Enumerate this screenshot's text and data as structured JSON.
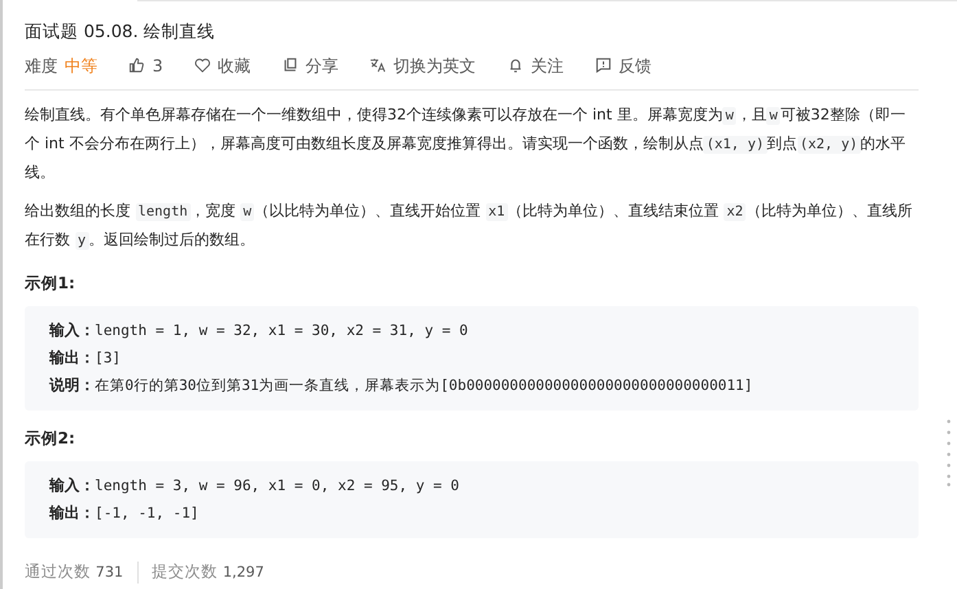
{
  "title": "面试题 05.08. 绘制直线",
  "meta": {
    "difficulty_label": "难度",
    "difficulty": "中等",
    "likes": "3",
    "actions": [
      {
        "kind": "star",
        "label": "收藏"
      },
      {
        "kind": "share",
        "label": "分享"
      },
      {
        "kind": "translate",
        "label": "切换为英文"
      },
      {
        "kind": "bell",
        "label": "关注"
      },
      {
        "kind": "feedback",
        "label": "反馈"
      }
    ]
  },
  "description": [
    [
      {
        "text": "绘制直线。有个单色屏幕存储在一个一维数组中，使得32个连续像素可以存放在一个 int 里。屏幕宽度为",
        "code": false
      },
      {
        "text": "w",
        "code": true
      },
      {
        "text": "，且",
        "code": false
      },
      {
        "text": "w",
        "code": true
      },
      {
        "text": "可被32整除（即一个 int 不会分布在两行上），屏幕高度可由数组长度及屏幕宽度推算得出。请实现一个函数，绘制从点",
        "code": false
      },
      {
        "text": "(x1, y)",
        "code": true
      },
      {
        "text": "到点",
        "code": false
      },
      {
        "text": "(x2, y)",
        "code": true
      },
      {
        "text": "的水平线。",
        "code": false
      }
    ],
    [
      {
        "text": "给出数组的长度 ",
        "code": false
      },
      {
        "text": "length",
        "code": true
      },
      {
        "text": "，宽度 ",
        "code": false
      },
      {
        "text": "w",
        "code": true
      },
      {
        "text": "（以比特为单位）、直线开始位置 ",
        "code": false
      },
      {
        "text": "x1",
        "code": true
      },
      {
        "text": "（比特为单位）、直线结束位置 ",
        "code": false
      },
      {
        "text": "x2",
        "code": true
      },
      {
        "text": "（比特为单位）、直线所在行数 ",
        "code": false
      },
      {
        "text": "y",
        "code": true
      },
      {
        "text": "。返回绘制过后的数组。",
        "code": false
      }
    ]
  ],
  "examples": [
    {
      "heading": "示例1:",
      "lines": [
        {
          "label": "输入：",
          "value": "length = 1, w = 32, x1 = 30, x2 = 31, y = 0"
        },
        {
          "label": "输出：",
          "value": "[3]"
        },
        {
          "label": "说明：",
          "value": "在第0行的第30位到第31为画一条直线，屏幕表示为[0b00000000000000000000000000000011]"
        }
      ]
    },
    {
      "heading": "示例2:",
      "lines": [
        {
          "label": "输入：",
          "value": "length = 3, w = 96, x1 = 0, x2 = 95, y = 0"
        },
        {
          "label": "输出：",
          "value": "[-1, -1, -1]"
        }
      ]
    }
  ],
  "stats": [
    {
      "label": "通过次数",
      "value": "731"
    },
    {
      "label": "提交次数",
      "value": "1,297"
    }
  ]
}
